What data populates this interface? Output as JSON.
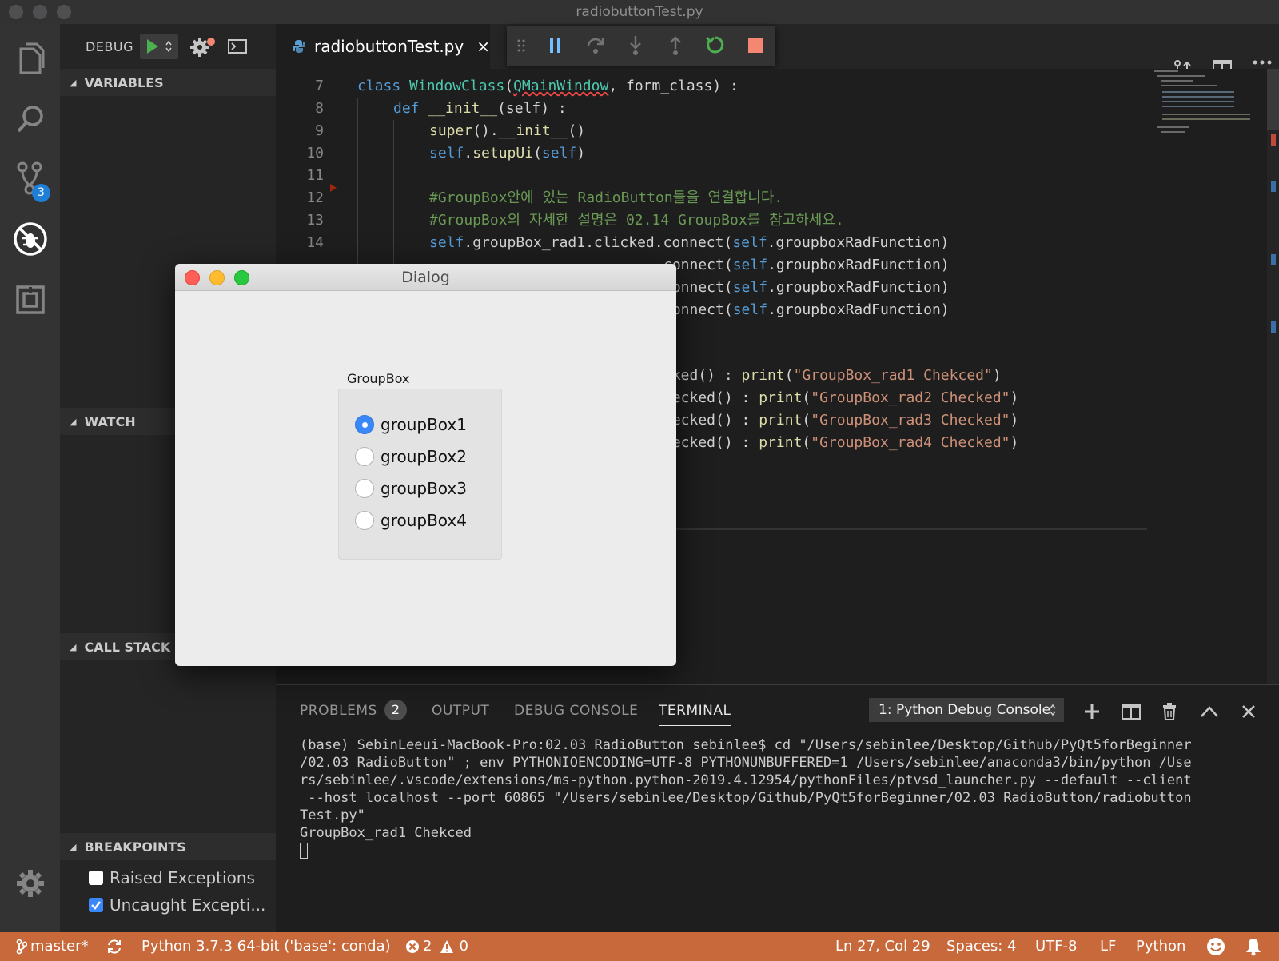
{
  "window": {
    "title": "radiobuttonTest.py"
  },
  "activity": {
    "scm_badge": "3"
  },
  "sidebar": {
    "debug_label": "DEBUG",
    "sections": {
      "variables": "VARIABLES",
      "watch": "WATCH",
      "call_stack": "CALL STACK",
      "breakpoints": "BREAKPOINTS"
    },
    "breakpoints": [
      {
        "label": "Raised Exceptions",
        "checked": false
      },
      {
        "label": "Uncaught Excepti...",
        "checked": true
      }
    ]
  },
  "editor": {
    "tab_name": "radiobuttonTest.py",
    "tab_close": "×",
    "line_numbers": [
      "7",
      "8",
      "9",
      "10",
      "11",
      "12",
      "13",
      "14"
    ],
    "lines": {
      "l7": {
        "kw": "class ",
        "cls": "WindowClass",
        "p1": "(",
        "base": "QMainWindow",
        "rest": ", form_class) :"
      },
      "l8": {
        "kw": "def ",
        "fn": "__init__",
        "rest": "(self) :"
      },
      "l9": {
        "fn": "super",
        "p1": "().",
        "fn2": "__init__",
        "rest": "()"
      },
      "l10": {
        "self": "self",
        "dot": ".",
        "fn": "setupUi",
        "p": "(",
        "self2": "self",
        "end": ")"
      },
      "l12": {
        "comment": "#GroupBox안에 있는 RadioButton들을 연결합니다."
      },
      "l13": {
        "comment": "#GroupBox의 자세한 설명은 02.14 GroupBox를 참고하세요."
      },
      "l14": {
        "self": "self",
        "rest": ".groupBox_rad1.clicked.connect(",
        "self2": "self",
        "end": ".groupboxRadFunction)"
      }
    },
    "partial_lines": {
      "c1": {
        "pre": "connect(",
        "self": "self",
        "post": ".groupboxRadFunction)"
      },
      "c2": {
        "pre": "connect(",
        "self": "self",
        "post": ".groupboxRadFunction)"
      },
      "c3": {
        "pre": "connect(",
        "self": "self",
        "post": ".groupboxRadFunction)"
      },
      "p1": {
        "pre": "cked() : ",
        "fn": "print",
        "p": "(",
        "str": "\"GroupBox_rad1 Chekced\"",
        "end": ")"
      },
      "p2": {
        "pre": "necked() : ",
        "fn": "print",
        "p": "(",
        "str": "\"GroupBox_rad2 Checked\"",
        "end": ")"
      },
      "p3": {
        "pre": "necked() : ",
        "fn": "print",
        "p": "(",
        "str": "\"GroupBox_rad3 Checked\"",
        "end": ")"
      },
      "p4": {
        "pre": "necked() : ",
        "fn": "print",
        "p": "(",
        "str": "\"GroupBox_rad4 Checked\"",
        "end": ")"
      }
    }
  },
  "panel": {
    "tabs": {
      "problems": "PROBLEMS",
      "output": "OUTPUT",
      "debug_console": "DEBUG CONSOLE",
      "terminal": "TERMINAL"
    },
    "problems_count": "2",
    "terminal_select": "1: Python Debug Console",
    "terminal_lines": [
      "(base) SebinLeeui-MacBook-Pro:02.03 RadioButton sebinlee$ cd \"/Users/sebinlee/Desktop/Github/PyQt5forBeginner",
      "/02.03 RadioButton\" ; env PYTHONIOENCODING=UTF-8 PYTHONUNBUFFERED=1 /Users/sebinlee/anaconda3/bin/python /Use",
      "rs/sebinlee/.vscode/extensions/ms-python.python-2019.4.12954/pythonFiles/ptvsd_launcher.py --default --client",
      " --host localhost --port 60865 \"/Users/sebinlee/Desktop/Github/PyQt5forBeginner/02.03 RadioButton/radiobutton",
      "Test.py\"",
      "GroupBox_rad1 Chekced"
    ]
  },
  "status": {
    "branch": "master*",
    "interpreter": "Python 3.7.3 64-bit ('base': conda)",
    "errors": "2",
    "warnings": "0",
    "position": "Ln 27, Col 29",
    "spaces": "Spaces: 4",
    "encoding": "UTF-8",
    "eol": "LF",
    "language": "Python"
  },
  "dialog": {
    "title": "Dialog",
    "groupbox_title": "GroupBox",
    "radios": [
      {
        "label": "groupBox1",
        "checked": true
      },
      {
        "label": "groupBox2",
        "checked": false
      },
      {
        "label": "groupBox3",
        "checked": false
      },
      {
        "label": "groupBox4",
        "checked": false
      }
    ]
  },
  "colors": {
    "status_bar": "#c8693c",
    "accent": "#3a87f7",
    "continue_green": "#4caf50",
    "stop_red": "#f48771"
  },
  "icons": [
    "explorer-icon",
    "search-icon",
    "source-control-icon",
    "debug-icon",
    "extensions-icon",
    "settings-gear-icon",
    "play-icon",
    "debug-config-gear-icon",
    "debug-console-icon",
    "python-file-icon",
    "drag-handle-icon",
    "pause-icon",
    "step-over-icon",
    "step-into-icon",
    "step-out-icon",
    "restart-icon",
    "stop-icon",
    "open-changes-icon",
    "split-editor-icon",
    "more-actions-icon",
    "add-terminal-icon",
    "split-terminal-icon",
    "trash-icon",
    "maximize-panel-icon",
    "close-panel-icon",
    "git-branch-icon",
    "sync-icon",
    "error-icon",
    "warning-icon",
    "feedback-smiley-icon",
    "notification-bell-icon"
  ]
}
